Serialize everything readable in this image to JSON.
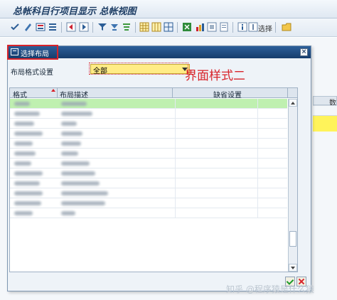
{
  "window": {
    "title": "总帐科目行项目显示 总帐视图"
  },
  "toolbar": {
    "select_label": "选择",
    "icons": [
      "check-icon",
      "edit-icon",
      "detail-icon",
      "list-icon",
      "previous-icon",
      "next-icon",
      "filter-icon",
      "sort-asc-icon",
      "sort-desc-icon",
      "layout-icon",
      "columns-icon",
      "grid-icon",
      "export-icon",
      "graphic-icon",
      "print-icon",
      "info-icon",
      "select-icon",
      "folder-icon"
    ]
  },
  "background_grid": {
    "header_partial": "数"
  },
  "dialog": {
    "title": "选择布局",
    "layout_setting_label": "布局格式设置",
    "layout_value": "全部",
    "annotation": "界面样式二",
    "table": {
      "columns": [
        "格式",
        "布局描述",
        "缺省设置"
      ],
      "row_count": 12,
      "selected_row": 0
    }
  },
  "watermark": "知乎 @程序猿是什么猿"
}
